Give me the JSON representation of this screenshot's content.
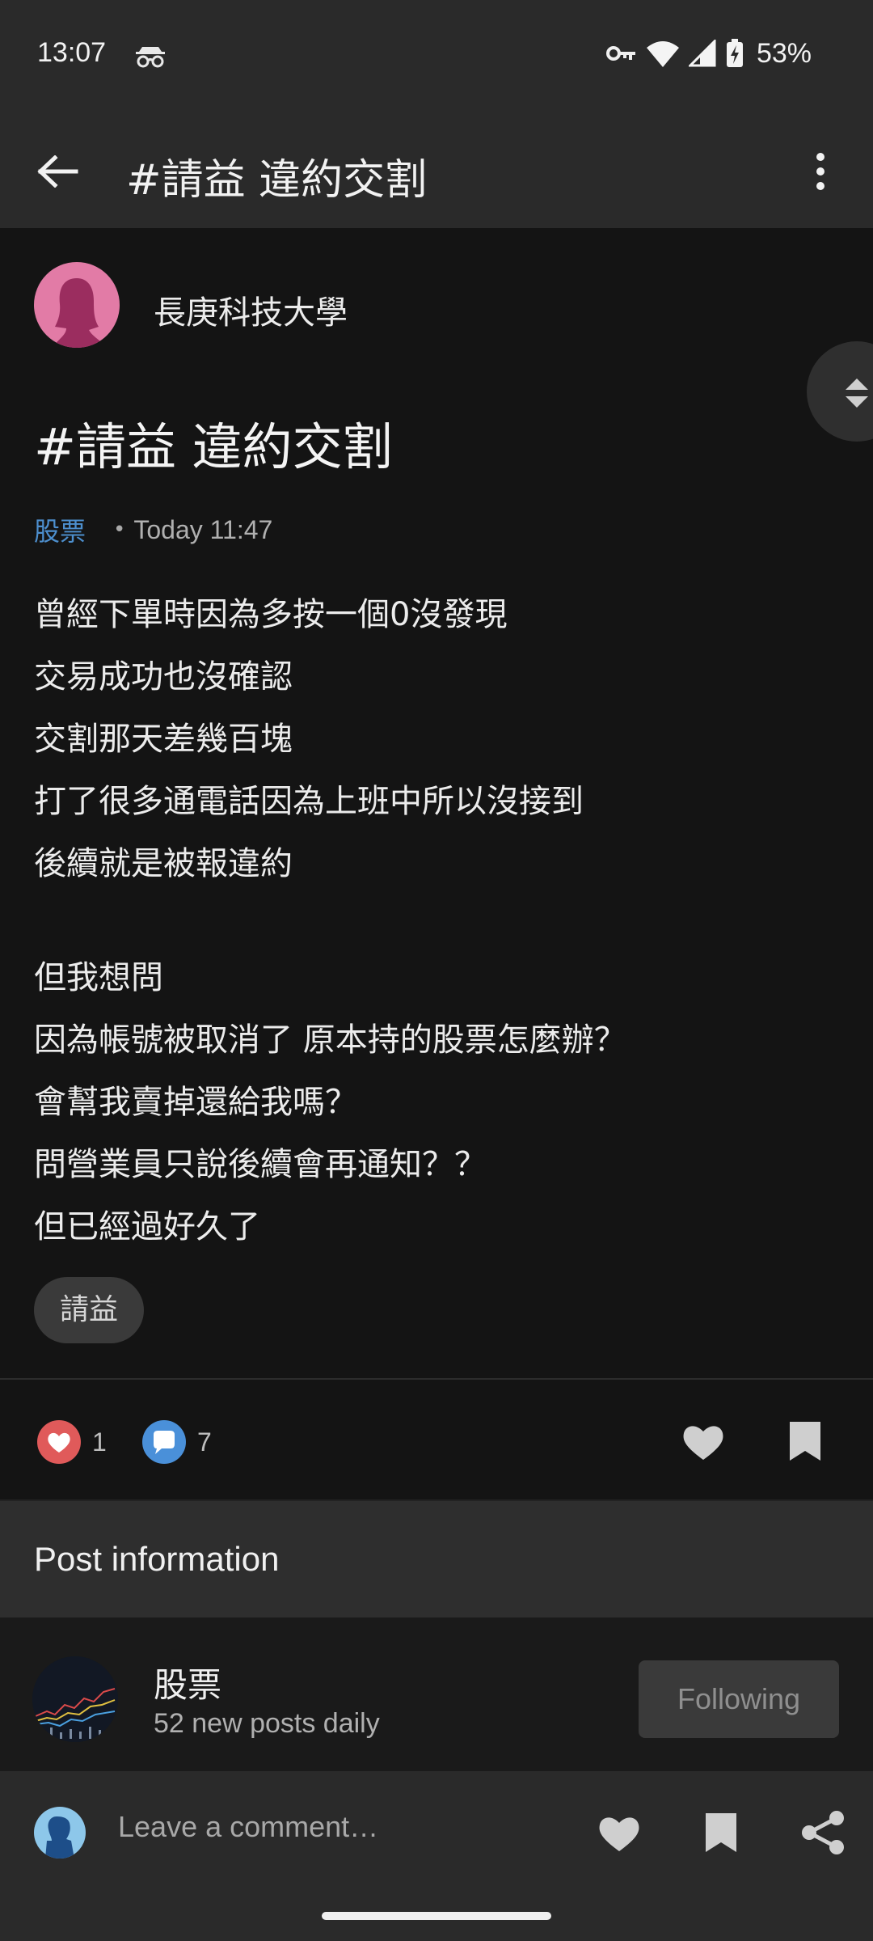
{
  "status_bar": {
    "time": "13:07",
    "battery": "53%"
  },
  "app_bar": {
    "title": "#請益 違約交割"
  },
  "post": {
    "author": "長庚科技大學",
    "title": "#請益 違約交割",
    "board": "股票",
    "time": "Today 11:47",
    "body_lines": [
      "曾經下單時因為多按一個0沒發現",
      "交易成功也沒確認",
      "交割那天差幾百塊",
      "打了很多通電話因為上班中所以沒接到",
      "後續就是被報違約",
      "",
      "但我想問",
      "因為帳號被取消了 原本持的股票怎麼辦？",
      "會幫我賣掉還給我嗎？",
      "問營業員只說後續會再通知？？",
      "但已經過好久了"
    ],
    "tag": "請益"
  },
  "reactions": {
    "like_count": "1",
    "comment_count": "7"
  },
  "post_info": {
    "header": "Post information",
    "board_name": "股票",
    "board_sub": "52 new posts daily",
    "follow_label": "Following"
  },
  "comment_bar": {
    "placeholder": "Leave a comment…"
  },
  "colors": {
    "accent_blue": "#4d8fce",
    "like_red": "#e05a5a",
    "comment_blue": "#4a90d9",
    "avatar_pink": "#e27ba6"
  }
}
